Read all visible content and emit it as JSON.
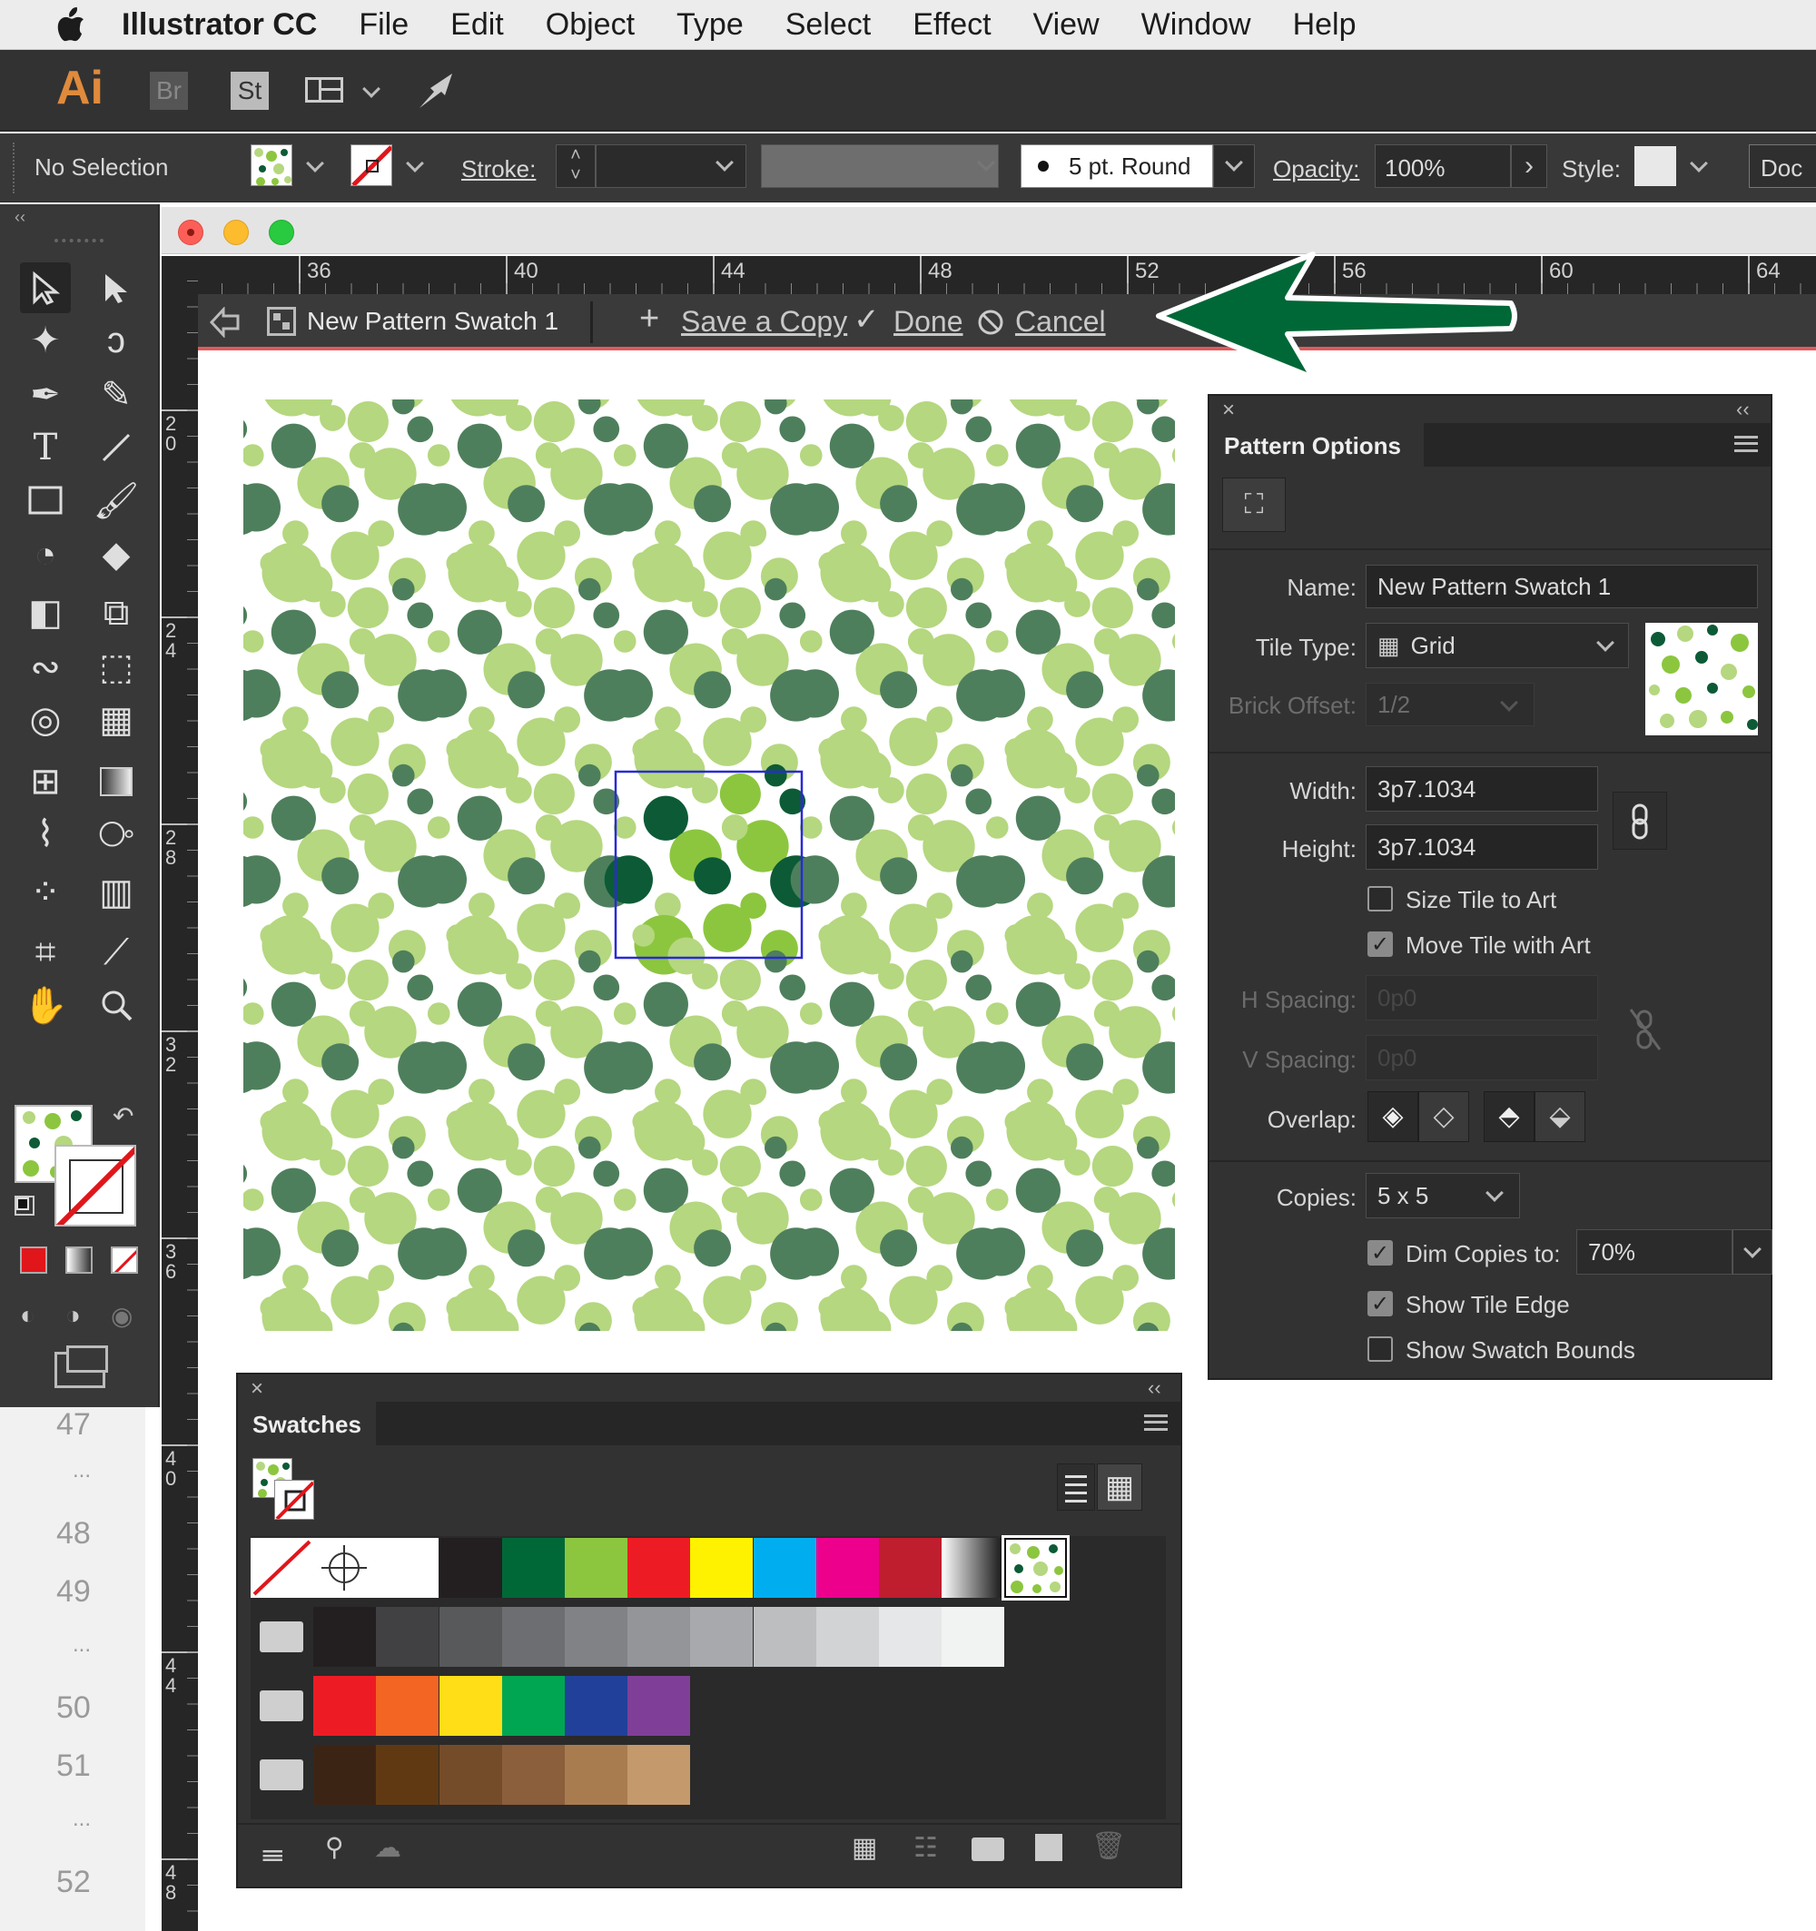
{
  "menubar": {
    "app_name": "Illustrator CC",
    "items": [
      "File",
      "Edit",
      "Object",
      "Type",
      "Select",
      "Effect",
      "View",
      "Window",
      "Help"
    ]
  },
  "appbar": {
    "logo": "Ai",
    "bridge": "Br",
    "stock": "St"
  },
  "control_bar": {
    "selection": "No Selection",
    "stroke_label": "Stroke:",
    "brush": "5 pt. Round",
    "opacity_label": "Opacity:",
    "opacity_value": "100%",
    "style_label": "Style:",
    "doc_label": "Doc"
  },
  "ruler": {
    "h_ticks": [
      "36",
      "40",
      "44",
      "48",
      "52",
      "56",
      "60",
      "64"
    ],
    "v_ticks": [
      "2\n0",
      "2\n4",
      "2\n8",
      "3\n2",
      "3\n6",
      "4\n0",
      "4\n4",
      "4\n8"
    ]
  },
  "left_strip": {
    "numbers": [
      "47",
      "...",
      "48",
      "49",
      "...",
      "50",
      "51",
      "...",
      "52"
    ]
  },
  "pattern_bar": {
    "swatch_name": "New Pattern Swatch 1",
    "save_copy": "Save a Copy",
    "done": "Done",
    "cancel": "Cancel"
  },
  "pattern_options": {
    "title": "Pattern Options",
    "name_label": "Name:",
    "name_value": "New Pattern Swatch 1",
    "tile_type_label": "Tile Type:",
    "tile_type_value": "Grid",
    "brick_offset_label": "Brick Offset:",
    "brick_offset_value": "1/2",
    "width_label": "Width:",
    "width_value": "3p7.1034",
    "height_label": "Height:",
    "height_value": "3p7.1034",
    "size_tile_label": "Size Tile to Art",
    "size_tile_checked": false,
    "move_tile_label": "Move Tile with Art",
    "move_tile_checked": true,
    "h_spacing_label": "H Spacing:",
    "h_spacing_value": "0p0",
    "v_spacing_label": "V Spacing:",
    "v_spacing_value": "0p0",
    "overlap_label": "Overlap:",
    "copies_label": "Copies:",
    "copies_value": "5 x 5",
    "dim_label": "Dim Copies to:",
    "dim_checked": true,
    "dim_value": "70%",
    "show_edge_label": "Show Tile Edge",
    "show_edge_checked": true,
    "show_bounds_label": "Show Swatch Bounds",
    "show_bounds_checked": false
  },
  "swatches": {
    "title": "Swatches",
    "row1": [
      "none",
      "registration",
      "#ffffff",
      "#231f20",
      "#006837",
      "#8cc63f",
      "#ed1c24",
      "#fff200",
      "#00aeef",
      "#ec008c",
      "#be1e2d",
      "gradient",
      "pattern"
    ],
    "row2": [
      "#231f20",
      "#414042",
      "#58595b",
      "#6d6e71",
      "#808285",
      "#939598",
      "#a7a9ac",
      "#bcbec0",
      "#d1d3d4",
      "#e6e7e8",
      "#f1f2f2"
    ],
    "row3": [
      "#ed1c24",
      "#f26522",
      "#ffde17",
      "#00a651",
      "#21409a",
      "#7f3f98"
    ],
    "row4": [
      "#3c2415",
      "#603913",
      "#754c29",
      "#8b5e3c",
      "#a97c50",
      "#c49a6c"
    ]
  },
  "colors": {
    "light_green": "#b5d77f",
    "mid_green": "#8cc63f",
    "dark_green": "#4e7f5c",
    "deep_green": "#0c5b36",
    "arrow_green": "#006837",
    "tile_edge": "#2a2ad6"
  }
}
